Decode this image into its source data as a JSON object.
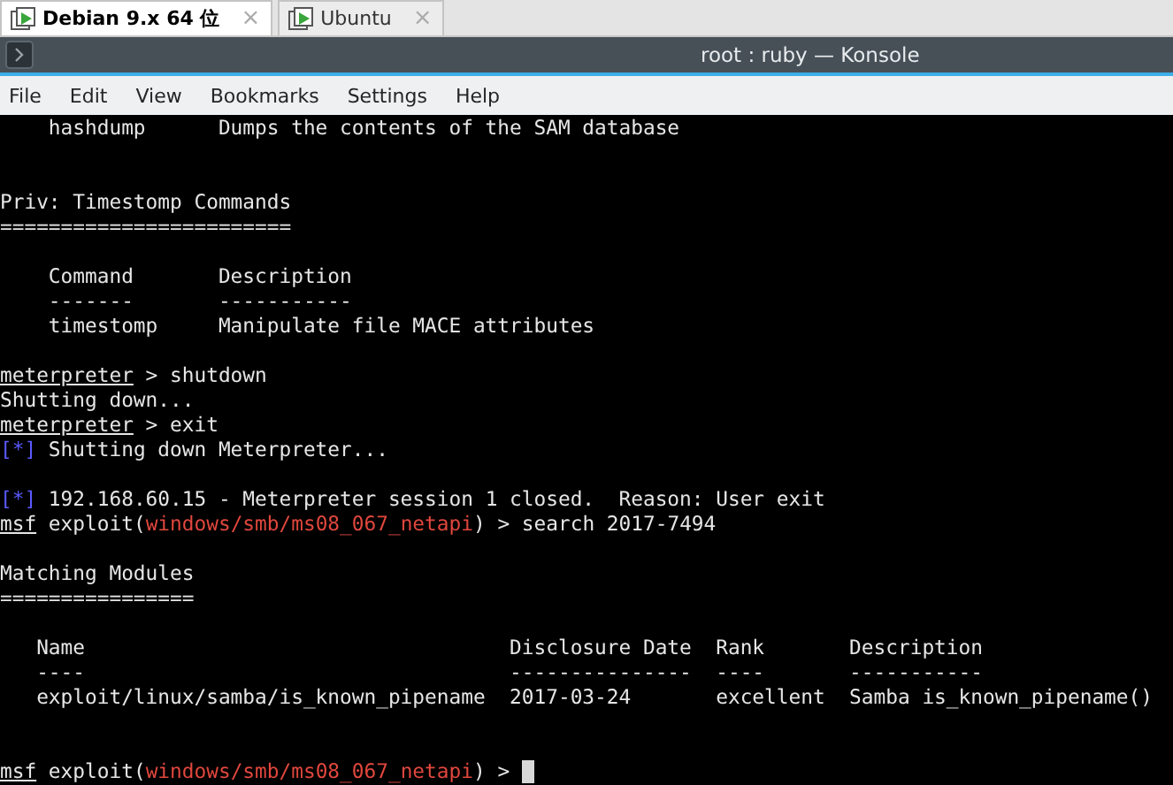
{
  "tabs": [
    {
      "label": "Debian 9.x 64 位",
      "selected": true,
      "close": "×"
    },
    {
      "label": "Ubuntu",
      "selected": false,
      "close": "×"
    }
  ],
  "window": {
    "title": "root : ruby — Konsole"
  },
  "menu": [
    "File",
    "Edit",
    "View",
    "Bookmarks",
    "Settings",
    "Help"
  ],
  "terminal": {
    "lines": [
      {
        "segments": [
          {
            "kind": "plain",
            "text": "    hashdump      Dumps the contents of the SAM database"
          }
        ]
      },
      {
        "kind": "blank"
      },
      {
        "kind": "blank"
      },
      {
        "segments": [
          {
            "kind": "plain",
            "text": "Priv: Timestomp Commands"
          }
        ]
      },
      {
        "segments": [
          {
            "kind": "plain",
            "text": "========================"
          }
        ]
      },
      {
        "kind": "blank"
      },
      {
        "segments": [
          {
            "kind": "plain",
            "text": "    Command       Description"
          }
        ]
      },
      {
        "segments": [
          {
            "kind": "plain",
            "text": "    -------       -----------"
          }
        ]
      },
      {
        "segments": [
          {
            "kind": "plain",
            "text": "    timestomp     Manipulate file MACE attributes"
          }
        ]
      },
      {
        "kind": "blank"
      },
      {
        "segments": [
          {
            "kind": "underline",
            "text": "meterpreter"
          },
          {
            "kind": "plain",
            "text": " > shutdown"
          }
        ]
      },
      {
        "segments": [
          {
            "kind": "plain",
            "text": "Shutting down..."
          }
        ]
      },
      {
        "segments": [
          {
            "kind": "underline",
            "text": "meterpreter"
          },
          {
            "kind": "plain",
            "text": " > exit"
          }
        ]
      },
      {
        "segments": [
          {
            "kind": "blue",
            "text": "[*]"
          },
          {
            "kind": "plain",
            "text": " Shutting down Meterpreter..."
          }
        ]
      },
      {
        "kind": "blank"
      },
      {
        "segments": [
          {
            "kind": "blue",
            "text": "[*]"
          },
          {
            "kind": "plain",
            "text": " 192.168.60.15 - Meterpreter session 1 closed.  Reason: User exit"
          }
        ]
      },
      {
        "segments": [
          {
            "kind": "underline",
            "text": "msf"
          },
          {
            "kind": "plain",
            "text": " exploit("
          },
          {
            "kind": "red",
            "text": "windows/smb/ms08_067_netapi"
          },
          {
            "kind": "plain",
            "text": ") > search 2017-7494"
          }
        ]
      },
      {
        "kind": "blank"
      },
      {
        "segments": [
          {
            "kind": "plain",
            "text": "Matching Modules"
          }
        ]
      },
      {
        "segments": [
          {
            "kind": "plain",
            "text": "================"
          }
        ]
      },
      {
        "kind": "blank"
      },
      {
        "segments": [
          {
            "kind": "plain",
            "text": "   Name                                   Disclosure Date  Rank       Description"
          }
        ]
      },
      {
        "segments": [
          {
            "kind": "plain",
            "text": "   ----                                   ---------------  ----       -----------"
          }
        ]
      },
      {
        "segments": [
          {
            "kind": "plain",
            "text": "   exploit/linux/samba/is_known_pipename  2017-03-24       excellent  Samba is_known_pipename()"
          }
        ]
      },
      {
        "kind": "blank"
      },
      {
        "kind": "blank"
      },
      {
        "segments": [
          {
            "kind": "underline",
            "text": "msf"
          },
          {
            "kind": "plain",
            "text": " exploit("
          },
          {
            "kind": "red",
            "text": "windows/smb/ms08_067_netapi"
          },
          {
            "kind": "plain",
            "text": ") > "
          }
        ],
        "cursor": true
      }
    ]
  }
}
